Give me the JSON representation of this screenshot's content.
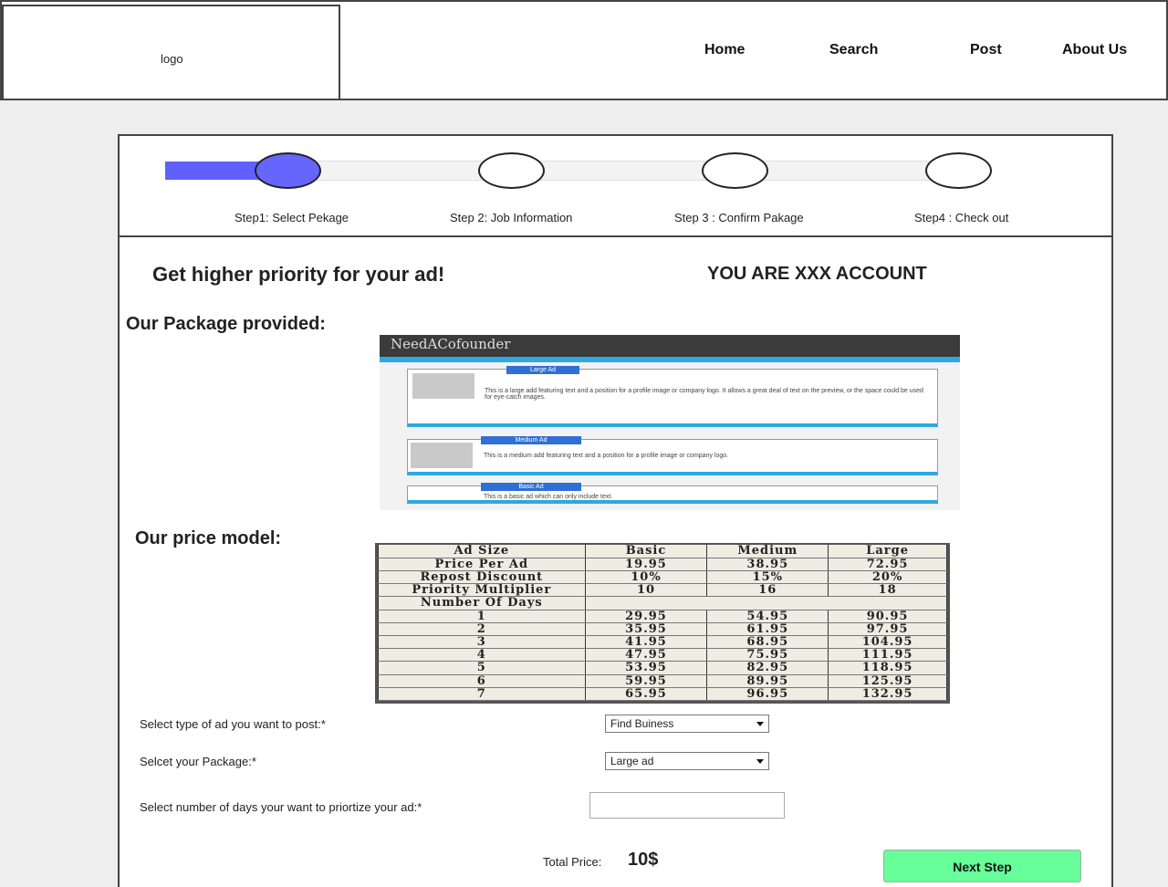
{
  "header": {
    "logo": "logo",
    "nav": [
      "Home",
      "Search",
      "Post",
      "About Us"
    ]
  },
  "steps": [
    {
      "label": "Step1: Select Pekage",
      "active": true
    },
    {
      "label": "Step 2: Job Information",
      "active": false
    },
    {
      "label": "Step 3 : Confirm Pakage",
      "active": false
    },
    {
      "label": "Step4 : Check out",
      "active": false
    }
  ],
  "main": {
    "title": "Get higher priority for your ad!",
    "account": "YOU ARE XXX ACCOUNT",
    "package_heading": "Our Package provided:",
    "price_heading": "Our price model:"
  },
  "package_preview": {
    "brand": "NeedACofounder",
    "ads": [
      {
        "tag": "Large Ad",
        "text": "This is a large add featuring text and a position for a profile image or company logo. It allows a great deal of text on the preview, or the space could be used for eye-catch images."
      },
      {
        "tag": "Medium Ad",
        "text": "This is a medium add featuring text and a position for a profile image or company logo."
      },
      {
        "tag": "Basic Ad",
        "text": "This is a basic ad which can only include text."
      }
    ]
  },
  "price_table": {
    "rows": [
      [
        "Ad Size",
        "Basic",
        "Medium",
        "Large"
      ],
      [
        "Price Per Ad",
        "19.95",
        "38.95",
        "72.95"
      ],
      [
        "Repost Discount",
        "10%",
        "15%",
        "20%"
      ],
      [
        "Priority Multiplier",
        "10",
        "16",
        "18"
      ],
      [
        "Number Of Days",
        "",
        "",
        ""
      ],
      [
        "1",
        "29.95",
        "54.95",
        "90.95"
      ],
      [
        "2",
        "35.95",
        "61.95",
        "97.95"
      ],
      [
        "3",
        "41.95",
        "68.95",
        "104.95"
      ],
      [
        "4",
        "47.95",
        "75.95",
        "111.95"
      ],
      [
        "5",
        "53.95",
        "82.95",
        "118.95"
      ],
      [
        "6",
        "59.95",
        "89.95",
        "125.95"
      ],
      [
        "7",
        "65.95",
        "96.95",
        "132.95"
      ]
    ]
  },
  "form": {
    "ad_type_label": "Select type of ad you want to post:*",
    "ad_type_value": "Find Buiness",
    "package_label": "Selcet your Package:*",
    "package_value": "Large ad",
    "days_label": "Select number of days your want to priortize your ad:*",
    "days_value": "",
    "total_label": "Total Price:",
    "total_value": "10$",
    "next_button": "Next Step"
  },
  "colors": {
    "step_active": "#6666ff",
    "next_button": "#66ff99",
    "ad_accent": "#2ea8e0"
  }
}
